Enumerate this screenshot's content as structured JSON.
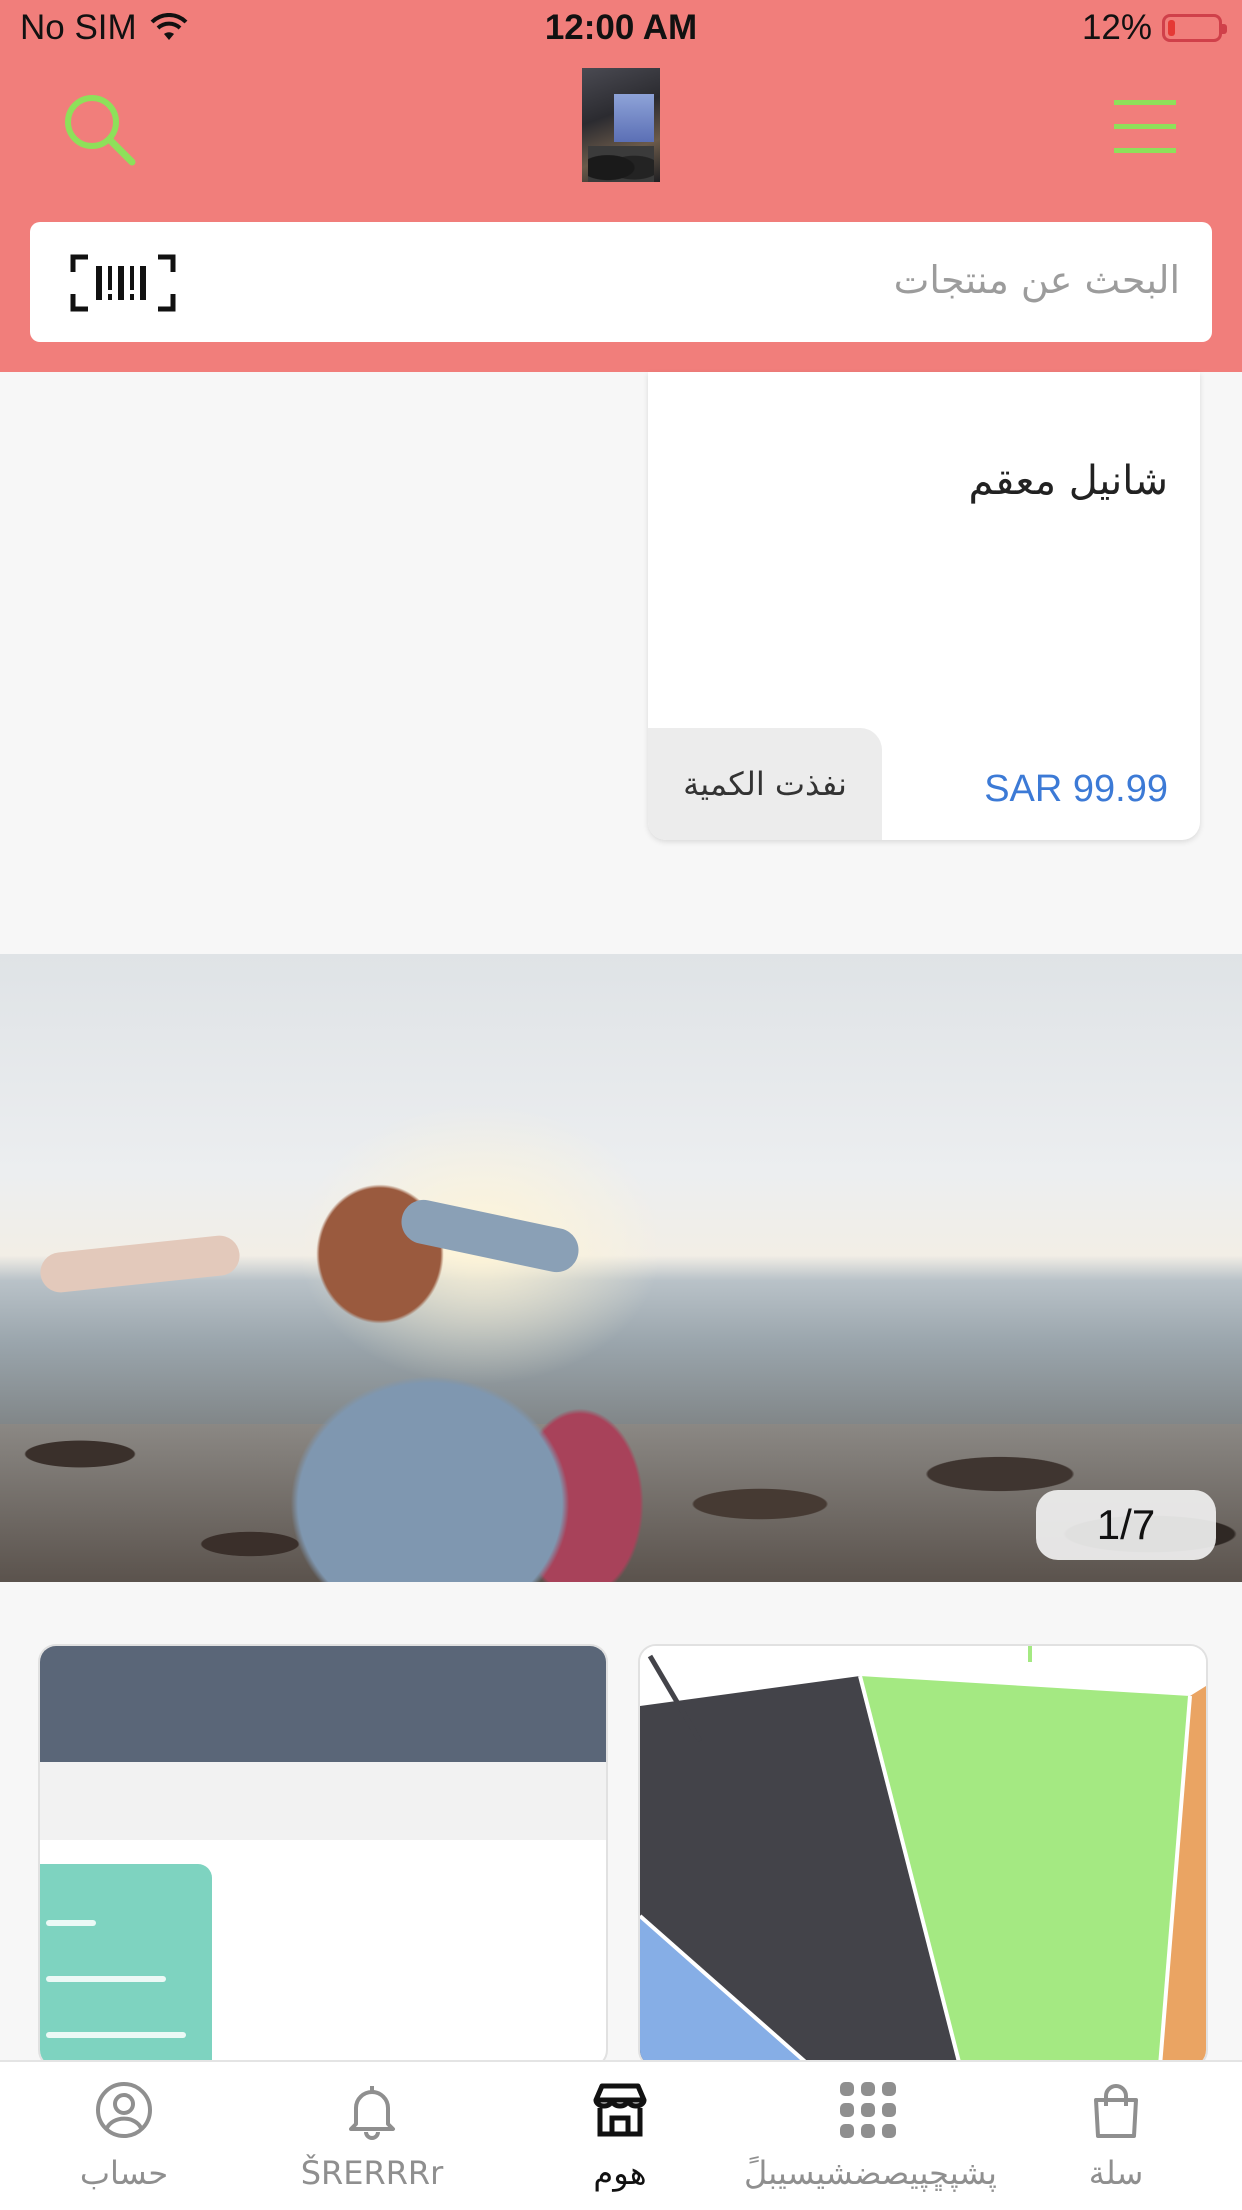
{
  "status_bar": {
    "carrier": "No SIM",
    "time": "12:00 AM",
    "battery": "12%"
  },
  "header": {
    "search_icon": "search-icon",
    "menu_icon": "hamburger-menu-icon",
    "logo": "store-logo"
  },
  "search": {
    "placeholder": "البحث عن منتجات",
    "barcode_icon": "barcode-scan-icon"
  },
  "product": {
    "title": "شانيل معقم",
    "price": "SAR 99.99",
    "stock_badge": "نفذت الكمية"
  },
  "banner": {
    "counter": "1/7"
  },
  "tab_bar": {
    "items": [
      {
        "label": "حساب",
        "icon": "user-circle-icon",
        "active": false
      },
      {
        "label": "ŠRERRRr",
        "icon": "bell-icon",
        "active": false
      },
      {
        "label": "هوم",
        "icon": "store-icon",
        "active": true
      },
      {
        "label": "پشپڇپیصضشيسيبلً",
        "icon": "grid-icon",
        "active": false
      },
      {
        "label": "سلة",
        "icon": "shopping-bag-icon",
        "active": false
      }
    ]
  },
  "colors": {
    "header": "#f17e7b",
    "accent_icon": "#8ee05a",
    "price": "#3c7ad6"
  }
}
